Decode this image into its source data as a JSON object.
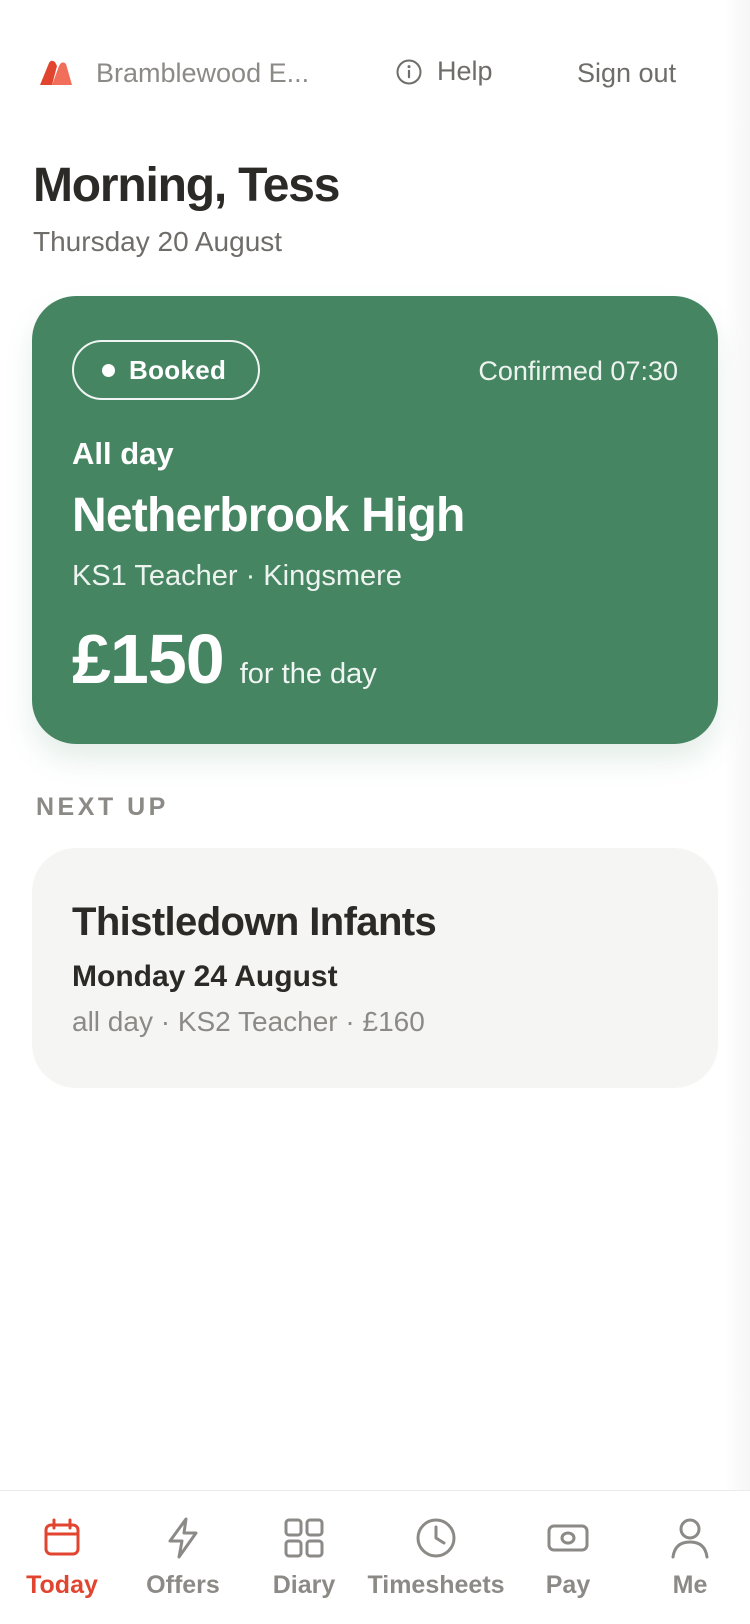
{
  "header": {
    "org_name": "Bramblewood E...",
    "help_label": "Help",
    "sign_out_label": "Sign out"
  },
  "greeting": {
    "title": "Morning, Tess",
    "date": "Thursday 20 August"
  },
  "booking": {
    "status": "Booked",
    "confirmed": "Confirmed 07:30",
    "duration": "All day",
    "school": "Netherbrook High",
    "role_location": "KS1 Teacher · Kingsmere",
    "pay": "£150",
    "pay_suffix": "for the day"
  },
  "next_up": {
    "heading": "NEXT UP",
    "school": "Thistledown Infants",
    "date": "Monday 24 August",
    "details": "all day · KS2 Teacher · £160"
  },
  "nav": {
    "items": [
      {
        "label": "Today",
        "icon": "calendar-icon",
        "active": true
      },
      {
        "label": "Offers",
        "icon": "lightning-icon",
        "active": false
      },
      {
        "label": "Diary",
        "icon": "grid-icon",
        "active": false
      },
      {
        "label": "Timesheets",
        "icon": "clock-icon",
        "active": false
      },
      {
        "label": "Pay",
        "icon": "money-icon",
        "active": false
      },
      {
        "label": "Me",
        "icon": "person-icon",
        "active": false
      }
    ]
  },
  "colors": {
    "accent": "#e2452f",
    "booked_card": "#468562",
    "next_card": "#f5f5f3",
    "text_primary": "#2c2a26",
    "text_muted": "#8c8a86"
  }
}
